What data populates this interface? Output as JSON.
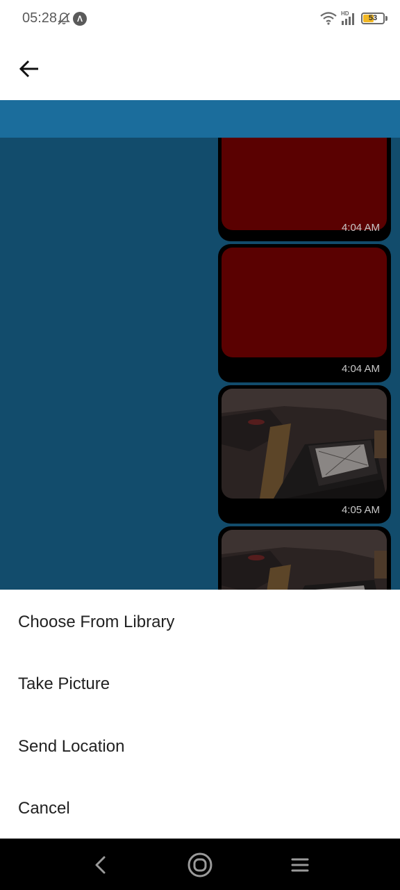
{
  "status_bar": {
    "time": "05:28",
    "battery_level": "53",
    "icons": [
      "bell-off-icon",
      "app-notification-icon",
      "wifi-icon",
      "hd-signal-icon",
      "battery-icon"
    ]
  },
  "header": {
    "back_icon": "arrow-left-icon"
  },
  "messages": [
    {
      "type": "image",
      "content": "red-image",
      "time": "4:04 AM"
    },
    {
      "type": "image",
      "content": "red-image",
      "time": "4:04 AM"
    },
    {
      "type": "image",
      "content": "photo-laptop",
      "time": "4:05 AM"
    },
    {
      "type": "image",
      "content": "photo-laptop",
      "time": ""
    }
  ],
  "action_sheet": {
    "options": [
      {
        "label": "Choose From Library"
      },
      {
        "label": "Take Picture"
      },
      {
        "label": "Send Location"
      },
      {
        "label": "Cancel"
      }
    ]
  },
  "nav_bar": {
    "icons": [
      "back-nav-icon",
      "home-nav-icon",
      "recents-nav-icon"
    ]
  },
  "colors": {
    "chat_background": "#124c6c",
    "chat_topbar": "#1b6d9c",
    "bubble_background": "#000000",
    "red_image": "#5a0101",
    "battery_fill": "#f2b824"
  }
}
